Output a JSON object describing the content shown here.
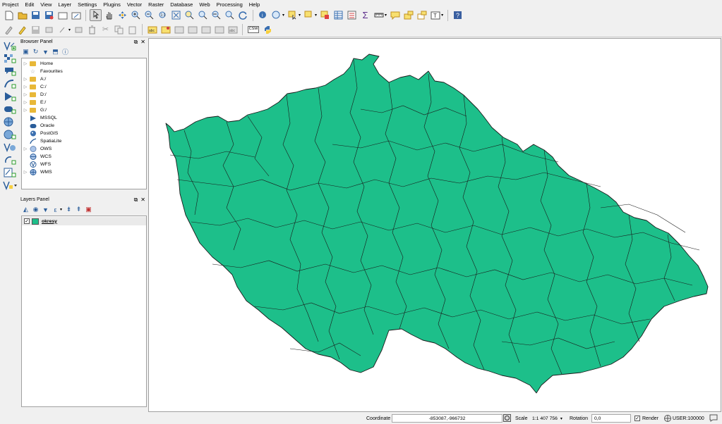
{
  "menu": [
    "Project",
    "Edit",
    "View",
    "Layer",
    "Settings",
    "Plugins",
    "Vector",
    "Raster",
    "Database",
    "Web",
    "Processing",
    "Help"
  ],
  "toolbar": {
    "csw_label": "CSW"
  },
  "browser_panel": {
    "title": "Browser Panel",
    "items": [
      {
        "label": "Home",
        "icon": "folder-icon",
        "expandable": true
      },
      {
        "label": "Favourites",
        "icon": "star-icon",
        "expandable": false
      },
      {
        "label": "A:/",
        "icon": "folder-icon",
        "expandable": true
      },
      {
        "label": "C:/",
        "icon": "folder-icon",
        "expandable": true
      },
      {
        "label": "D:/",
        "icon": "folder-icon",
        "expandable": true
      },
      {
        "label": "E:/",
        "icon": "folder-icon",
        "expandable": true
      },
      {
        "label": "G:/",
        "icon": "folder-icon",
        "expandable": true
      },
      {
        "label": "MSSQL",
        "icon": "mssql-icon",
        "expandable": false
      },
      {
        "label": "Oracle",
        "icon": "oracle-icon",
        "expandable": false
      },
      {
        "label": "PostGIS",
        "icon": "postgis-icon",
        "expandable": false
      },
      {
        "label": "SpatiaLite",
        "icon": "spatialite-icon",
        "expandable": false
      },
      {
        "label": "OWS",
        "icon": "ows-icon",
        "expandable": true
      },
      {
        "label": "WCS",
        "icon": "wcs-icon",
        "expandable": false
      },
      {
        "label": "WFS",
        "icon": "wfs-icon",
        "expandable": false
      },
      {
        "label": "WMS",
        "icon": "wms-icon",
        "expandable": true
      }
    ]
  },
  "layers_panel": {
    "title": "Layers Panel",
    "layers": [
      {
        "name": "okresy",
        "checked": true,
        "color": "#1dbf8a"
      }
    ]
  },
  "map": {
    "fill_color": "#1dbf8a",
    "stroke_color": "#1a1a1a"
  },
  "status": {
    "coordinate_label": "Coordinate",
    "coordinate_value": "-853087,-966732",
    "scale_label": "Scale",
    "scale_value": "1:1 407 756",
    "rotation_label": "Rotation",
    "rotation_value": "0,0",
    "render_label": "Render",
    "crs_label": "USER:100000"
  }
}
